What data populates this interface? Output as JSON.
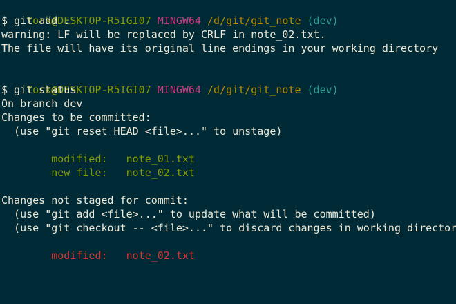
{
  "colors": {
    "background": "#002b36",
    "text": "#eee8d5",
    "user": "#859900",
    "shell": "#d33682",
    "path": "#b58900",
    "branch": "#2aa198",
    "staged": "#859900",
    "unstaged": "#dc322f"
  },
  "prompt": {
    "user_host": "York@DESKTOP-R5IGI07",
    "shell": "MINGW64",
    "path": "/d/git/git_note",
    "branch": "(dev)"
  },
  "session": [
    {
      "command": "$ git add .",
      "output": [
        "warning: LF will be replaced by CRLF in note_02.txt.",
        "The file will have its original line endings in your working directory"
      ]
    },
    {
      "command": "$ git status",
      "output": [
        "On branch dev",
        "Changes to be committed:",
        "  (use \"git reset HEAD <file>...\" to unstage)"
      ],
      "staged": [
        {
          "status": "modified:",
          "file": "note_01.txt"
        },
        {
          "status": "new file:",
          "file": "note_02.txt"
        }
      ],
      "unstaged_header": [
        "Changes not staged for commit:",
        "  (use \"git add <file>...\" to update what will be committed)",
        "  (use \"git checkout -- <file>...\" to discard changes in working directory)"
      ],
      "unstaged": [
        {
          "status": "modified:",
          "file": "note_02.txt"
        }
      ]
    }
  ]
}
